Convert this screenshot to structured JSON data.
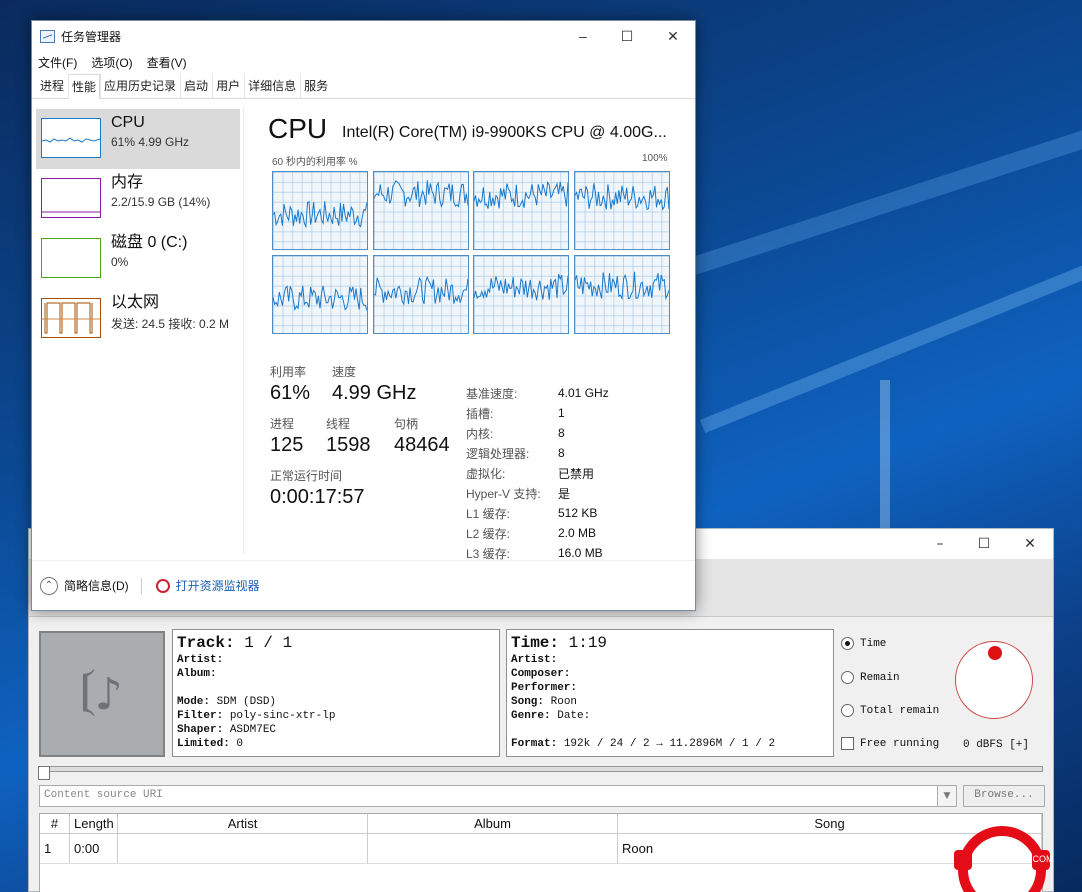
{
  "task_manager": {
    "title": "任务管理器",
    "menu": [
      "文件(F)",
      "选项(O)",
      "查看(V)"
    ],
    "tabs": [
      "进程",
      "性能",
      "应用历史记录",
      "启动",
      "用户",
      "详细信息",
      "服务"
    ],
    "active_tab": "性能",
    "sidebar": [
      {
        "name": "CPU",
        "sub": "61% 4.99 GHz",
        "color": "#1979ca"
      },
      {
        "name": "内存",
        "sub": "2.2/15.9 GB (14%)",
        "color": "#8b1ea0"
      },
      {
        "name": "磁盘 0 (C:)",
        "sub": "0%",
        "color": "#4da60c"
      },
      {
        "name": "以太网",
        "sub": "发送: 24.5 接收: 0.2 M",
        "color": "#a74f01"
      }
    ],
    "cpu_heading": "CPU",
    "cpu_model": "Intel(R) Core(TM) i9-9900KS CPU @ 4.00G...",
    "graph_caption_left": "60 秒内的利用率 %",
    "graph_caption_right": "100%",
    "stats": {
      "util_label": "利用率",
      "util_value": "61%",
      "speed_label": "速度",
      "speed_value": "4.99 GHz",
      "proc_label": "进程",
      "proc_value": "125",
      "thread_label": "线程",
      "thread_value": "1598",
      "handle_label": "句柄",
      "handle_value": "48464",
      "uptime_label": "正常运行时间",
      "uptime_value": "0:00:17:57"
    },
    "specs": [
      {
        "k": "基准速度:",
        "v": "4.01 GHz"
      },
      {
        "k": "插槽:",
        "v": "1"
      },
      {
        "k": "内核:",
        "v": "8"
      },
      {
        "k": "逻辑处理器:",
        "v": "8"
      },
      {
        "k": "虚拟化:",
        "v": "已禁用"
      },
      {
        "k": "Hyper-V 支持:",
        "v": "是"
      },
      {
        "k": "L1 缓存:",
        "v": "512 KB"
      },
      {
        "k": "L2 缓存:",
        "v": "2.0 MB"
      },
      {
        "k": "L3 缓存:",
        "v": "16.0 MB"
      }
    ],
    "footer": {
      "summary": "简略信息(D)",
      "monitor": "打开资源监视器"
    }
  },
  "player": {
    "track_label": "Track:",
    "track_value": "1 / 1",
    "left_fields": [
      {
        "k": "Artist:",
        "v": ""
      },
      {
        "k": "Album:",
        "v": ""
      },
      {
        "k": "",
        "v": ""
      },
      {
        "k": "Mode:",
        "v": "SDM (DSD)"
      },
      {
        "k": "Filter:",
        "v": "poly-sinc-xtr-lp"
      },
      {
        "k": "Shaper:",
        "v": "ASDM7EC"
      },
      {
        "k": "Limited:",
        "v": "0"
      }
    ],
    "time_label": "Time:",
    "time_value": "1:19",
    "right_fields": [
      {
        "k": "Artist:",
        "v": ""
      },
      {
        "k": "Composer:",
        "v": ""
      },
      {
        "k": "Performer:",
        "v": ""
      },
      {
        "k": "Song:",
        "v": "Roon"
      },
      {
        "k": "Genre:",
        "v": "     Date:"
      }
    ],
    "format_label": "Format:",
    "format_value": "192k / 24 / 2 → 11.2896M / 1 / 2",
    "radios": [
      "Time",
      "Remain",
      "Total remain"
    ],
    "selected_radio": "Time",
    "free_running": "Free running",
    "dbfs": "0 dBFS [+]",
    "uri_placeholder": "Content source URI",
    "browse": "Browse...",
    "table_headers": [
      "#",
      "Length",
      "Artist",
      "Album",
      "Song"
    ],
    "table_rows": [
      {
        "num": "1",
        "length": "0:00",
        "artist": "",
        "album": "",
        "song": "Roon"
      }
    ]
  },
  "logo_text": ".COM",
  "colors": {
    "cpu_graph": "#1979ca",
    "accent_red": "#e30c17"
  }
}
